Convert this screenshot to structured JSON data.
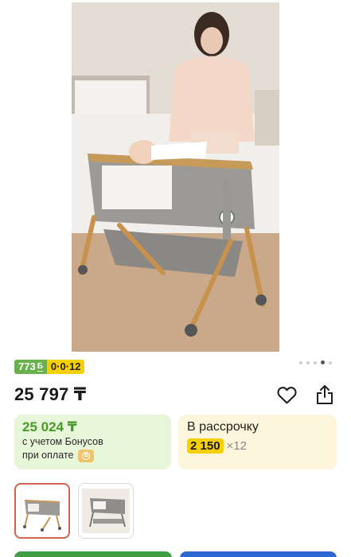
{
  "product": {
    "bonus_badge": "773",
    "bonus_badge_mark": "Б",
    "installment_badge": "0·0·12",
    "price": "25 797 ₸"
  },
  "gallery": {
    "image_count": 5,
    "active_index": 3
  },
  "bonus_card": {
    "amount": "25 024 ₸",
    "line1": "с учетом Бонусов",
    "line2": "при оплате"
  },
  "installment_card": {
    "title": "В рассрочку",
    "monthly": "2 150",
    "multiplier": "×12"
  },
  "icons": {
    "favorite": "heart-icon",
    "share": "share-icon",
    "coin": "bonus-coin-icon"
  },
  "colors": {
    "bonus_green": "#6ab04c",
    "installment_yellow": "#f5d000",
    "thumb_selected": "#d3644c",
    "primary_button": "#3e9e43",
    "secondary_button": "#2d67d1"
  }
}
